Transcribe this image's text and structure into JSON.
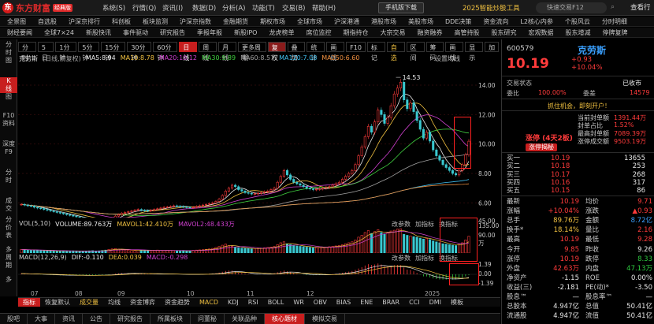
{
  "app": {
    "logo_mark": "东",
    "logo_text": "东方财富",
    "logo_badge": "经典版",
    "menu": [
      "系统(S)",
      "行情(Q)",
      "资讯(I)",
      "数据(D)",
      "分析(A)",
      "功能(T)",
      "交易(B)",
      "帮助(H)"
    ],
    "mobile_btn": "手机版下载",
    "promo": "2025智能炒股工具",
    "shortcut": "快速交易F12",
    "quote_tab": "查看行"
  },
  "nav1": [
    "全景图",
    "自选股",
    "沪深京排行",
    "科创板",
    "板块监测",
    "沪深京指数",
    "金融期货",
    "期权市场",
    "全球市场",
    "沪深港通",
    "港股市场",
    "美股市场",
    "DDE决策",
    "资金流向",
    "L2核心内参",
    "个股风云",
    "分时明细"
  ],
  "nav2": [
    "财经要闻",
    "全球7×24",
    "新股快讯",
    "事件驱动",
    "研究报告",
    "季报年报",
    "新股IPO",
    "龙虎榜单",
    "席位监控",
    "期指持仓",
    "大宗交易",
    "融资融券",
    "高管持股",
    "股东研究",
    "宏观数据",
    "股东增减",
    "停牌复牌"
  ],
  "rail": [
    "分",
    "时",
    "图",
    "K",
    "线",
    "图",
    "F10",
    "资料",
    "深度",
    "F9",
    "分",
    "时",
    "成",
    "交",
    "分",
    "价",
    "表",
    "多",
    "周",
    "期",
    "多"
  ],
  "periods": [
    "分时",
    "5日",
    "1分钟",
    "5分钟",
    "15分钟",
    "30分钟",
    "60分钟",
    "日线",
    "周线",
    "月线",
    "更多周期"
  ],
  "head_buttons": [
    "复权",
    "叠加",
    "统计",
    "画线",
    "F10",
    "标记",
    "自选",
    "区间",
    "筹码",
    "画线",
    "显示",
    "加"
  ],
  "chart_head": {
    "stock_name": "克劳斯",
    "mode": "(日线,前复权)",
    "setting": "设置均线"
  },
  "ma": [
    {
      "label": "MA5:8.94",
      "color": "#e8e8e8"
    },
    {
      "label": "MA10:8.78",
      "color": "#f0c040"
    },
    {
      "label": "MA20:10.12",
      "color": "#d040d0"
    },
    {
      "label": "MA30:9.89",
      "color": "#40d040"
    },
    {
      "label": "MA60:8.57",
      "color": "#a0a0a0"
    },
    {
      "label": "MA120:7.08",
      "color": "#40c0f0"
    },
    {
      "label": "MA250:6.60",
      "color": "#f09040"
    }
  ],
  "vol_head": [
    {
      "label": "VOL(5,10)",
      "color": "#ccc"
    },
    {
      "label": "VOLUME:89.763万",
      "color": "#e8e8e8"
    },
    {
      "label": "MAVOL1:42.410万",
      "color": "#f0c040"
    },
    {
      "label": "MAVOL2:48.433万",
      "color": "#d040d0"
    }
  ],
  "macd_head": [
    {
      "label": "MACD(12,26,9)",
      "color": "#ccc"
    },
    {
      "label": "DIF:-0.110",
      "color": "#e8e8e8"
    },
    {
      "label": "DEA:0.039",
      "color": "#f0c040"
    },
    {
      "label": "MACD:-0.298",
      "color": "#d040d0"
    }
  ],
  "pane_tools": [
    "改参数",
    "加指标",
    "换指标"
  ],
  "indicator_tabs": [
    "指标",
    "恢复默认",
    "成交量",
    "均线",
    "资金博弈",
    "资金趋势",
    "MACD",
    "KDJ",
    "RSI",
    "BOLL",
    "WR",
    "OBV",
    "BIAS",
    "ENE",
    "BRAR",
    "CCI",
    "DMI",
    "模板"
  ],
  "bottom_tabs": [
    "股吧",
    "大事",
    "资讯",
    "公告",
    "研究报告",
    "所属板块",
    "问董秘",
    "关联品种",
    "核心题材",
    "模拟交易"
  ],
  "chart_data": {
    "type": "candlestick",
    "y_ticks": [
      "14.00",
      "12.00",
      "10.00",
      "8.00",
      "6.00"
    ],
    "ylim": [
      5.0,
      15.5
    ],
    "x_ticks": [
      "07",
      "08",
      "09",
      "10",
      "11",
      "12",
      "2025"
    ],
    "annotations": [
      {
        "label": "14.53",
        "x_index": 117,
        "y": 14.53
      },
      {
        "label": "4.69",
        "x_index": 26,
        "y": 4.69
      }
    ],
    "vol_ticks": [
      "135.00",
      "90.00",
      "45.00",
      "万"
    ],
    "macd_ticks": [
      "1.39",
      "0.00",
      "-1.39"
    ],
    "closes": [
      5.9,
      5.85,
      5.8,
      5.78,
      5.7,
      5.65,
      5.62,
      5.55,
      5.5,
      5.45,
      5.4,
      5.35,
      5.3,
      5.25,
      5.2,
      5.15,
      5.1,
      5.05,
      5.0,
      4.95,
      4.9,
      4.85,
      4.8,
      4.78,
      4.75,
      4.72,
      4.7,
      4.8,
      4.95,
      5.1,
      5.2,
      5.3,
      5.35,
      5.4,
      5.45,
      5.5,
      5.55,
      5.5,
      5.48,
      5.45,
      5.5,
      5.55,
      5.6,
      5.65,
      5.7,
      5.72,
      5.75,
      5.8,
      5.78,
      5.75,
      5.72,
      5.7,
      5.68,
      5.7,
      5.75,
      5.8,
      5.85,
      5.9,
      5.95,
      6.0,
      6.1,
      6.25,
      6.5,
      6.8,
      7.0,
      7.2,
      7.1,
      6.9,
      6.8,
      6.7,
      6.65,
      6.6,
      6.62,
      6.65,
      6.7,
      6.75,
      6.8,
      6.9,
      7.0,
      7.4,
      7.8,
      8.2,
      7.9,
      7.6,
      7.4,
      7.3,
      7.2,
      7.1,
      7.0,
      6.95,
      6.9,
      6.92,
      6.95,
      7.0,
      7.05,
      7.1,
      7.2,
      7.3,
      7.4,
      7.6,
      7.8,
      8.0,
      8.2,
      8.6,
      9.2,
      9.8,
      10.5,
      11.2,
      10.8,
      11.5,
      12.3,
      12.0,
      11.4,
      11.8,
      12.6,
      13.4,
      13.8,
      14.2,
      13.0,
      12.4,
      12.8,
      12.2,
      11.6,
      11.0,
      10.4,
      10.8,
      10.2,
      9.6,
      9.2,
      8.9,
      8.6,
      8.4,
      8.2,
      8.0,
      7.9,
      8.2,
      8.6,
      9.27,
      10.19
    ],
    "volumes": [
      20,
      18,
      17,
      15,
      14,
      16,
      15,
      13,
      12,
      14,
      12,
      11,
      13,
      12,
      10,
      11,
      12,
      10,
      9,
      11,
      10,
      12,
      13,
      11,
      12,
      14,
      16,
      20,
      22,
      24,
      21,
      18,
      17,
      16,
      15,
      14,
      16,
      15,
      14,
      13,
      14,
      15,
      16,
      14,
      13,
      15,
      14,
      13,
      12,
      13,
      14,
      12,
      13,
      15,
      16,
      17,
      18,
      20,
      22,
      25,
      30,
      35,
      42,
      48,
      40,
      36,
      30,
      28,
      26,
      25,
      24,
      23,
      24,
      25,
      26,
      28,
      30,
      32,
      35,
      45,
      55,
      60,
      50,
      45,
      40,
      38,
      36,
      34,
      32,
      30,
      28,
      29,
      30,
      31,
      32,
      34,
      36,
      38,
      40,
      44,
      50,
      55,
      60,
      70,
      85,
      95,
      110,
      120,
      105,
      115,
      125,
      110,
      100,
      108,
      118,
      122,
      128,
      130,
      100,
      95,
      92,
      88,
      85,
      80,
      75,
      78,
      72,
      65,
      60,
      55,
      50,
      48,
      45,
      42,
      40,
      46,
      55,
      70,
      90
    ],
    "macd": [
      0.05,
      0.04,
      0.03,
      0.02,
      0.01,
      0.0,
      -0.01,
      -0.02,
      -0.03,
      -0.04,
      -0.05,
      -0.05,
      -0.06,
      -0.06,
      -0.06,
      -0.07,
      -0.07,
      -0.07,
      -0.07,
      -0.07,
      -0.07,
      -0.07,
      -0.06,
      -0.06,
      -0.05,
      -0.05,
      -0.04,
      -0.02,
      0.01,
      0.04,
      0.06,
      0.07,
      0.07,
      0.07,
      0.06,
      0.06,
      0.05,
      0.04,
      0.03,
      0.02,
      0.02,
      0.02,
      0.02,
      0.02,
      0.02,
      0.02,
      0.01,
      0.01,
      0.0,
      0.0,
      -0.01,
      -0.01,
      -0.01,
      0.0,
      0.0,
      0.01,
      0.02,
      0.03,
      0.04,
      0.05,
      0.07,
      0.1,
      0.15,
      0.2,
      0.22,
      0.22,
      0.18,
      0.12,
      0.08,
      0.05,
      0.03,
      0.01,
      0.0,
      0.0,
      0.01,
      0.02,
      0.03,
      0.05,
      0.07,
      0.12,
      0.18,
      0.22,
      0.18,
      0.12,
      0.06,
      0.03,
      0.0,
      -0.02,
      -0.04,
      -0.05,
      -0.05,
      -0.04,
      -0.03,
      -0.02,
      -0.01,
      0.0,
      0.02,
      0.04,
      0.06,
      0.09,
      0.12,
      0.16,
      0.2,
      0.26,
      0.34,
      0.42,
      0.52,
      0.6,
      0.55,
      0.58,
      0.64,
      0.58,
      0.48,
      0.46,
      0.5,
      0.54,
      0.55,
      0.54,
      0.4,
      0.28,
      0.26,
      0.18,
      0.08,
      -0.02,
      -0.12,
      -0.12,
      -0.18,
      -0.24,
      -0.28,
      -0.3,
      -0.31,
      -0.31,
      -0.31,
      -0.31,
      -0.3,
      -0.26,
      -0.2,
      -0.12,
      -0.05
    ]
  },
  "rpanel": {
    "code": "600579",
    "name": "克劳斯",
    "price": "10.19",
    "chg": "+0.93",
    "chg_pct": "+10.04%",
    "status_label": "交易状态",
    "status_value": "已收市",
    "weibi_label": "委比",
    "weibi_value": "100.00%",
    "weicha_label": "委差",
    "weicha_value": "14579",
    "promo": "抓住机会，即刻开户！",
    "limit_title": "涨停 (4天2板)",
    "limit_badge": "涨停揭秘",
    "limit_stats": [
      {
        "label": "当前封单额",
        "value": "1391.44万"
      },
      {
        "label": "封单占比",
        "value": "1.52%"
      },
      {
        "label": "最高封单额",
        "value": "7089.39万"
      },
      {
        "label": "涨停成交额",
        "value": "9503.19万"
      }
    ],
    "book": [
      {
        "label": "买一",
        "price": "10.19",
        "vol": "13655"
      },
      {
        "label": "买二",
        "price": "10.18",
        "vol": "253"
      },
      {
        "label": "买三",
        "price": "10.17",
        "vol": "268"
      },
      {
        "label": "买四",
        "price": "10.16",
        "vol": "317"
      },
      {
        "label": "买五",
        "price": "10.15",
        "vol": "86"
      }
    ],
    "stats": [
      {
        "a": "最新",
        "av": "10.19",
        "ac": "red",
        "b": "均价",
        "bv": "9.71",
        "bc": "red"
      },
      {
        "a": "涨幅",
        "av": "+10.04%",
        "ac": "red",
        "b": "涨跌",
        "bv": "▲0.93",
        "bc": "red"
      },
      {
        "a": "总手",
        "av": "89.76万",
        "ac": "yellowc",
        "b": "金额",
        "bv": "8.72亿",
        "bc": "blue"
      },
      {
        "a": "换手*",
        "av": "18.14%",
        "ac": "yellowc",
        "b": "量比",
        "bv": "2.16",
        "bc": "red"
      },
      {
        "a": "最高",
        "av": "10.19",
        "ac": "red",
        "b": "最低",
        "bv": "9.28",
        "bc": "red"
      },
      {
        "a": "今开",
        "av": "9.85",
        "ac": "red",
        "b": "昨收",
        "bv": "9.26",
        "bc": "white"
      },
      {
        "a": "涨停",
        "av": "10.19",
        "ac": "red",
        "b": "跌停",
        "bv": "8.33",
        "bc": "green"
      },
      {
        "a": "外盘",
        "av": "42.63万",
        "ac": "red",
        "b": "内盘",
        "bv": "47.13万",
        "bc": "green"
      },
      {
        "a": "净资产",
        "av": "-1.15",
        "ac": "white",
        "b": "ROE",
        "bv": "0.00%",
        "bc": "white"
      },
      {
        "a": "收益(三)",
        "av": "-2.181",
        "ac": "white",
        "b": "PE(动)*",
        "bv": "-3.50",
        "bc": "white"
      },
      {
        "a": "股息™",
        "av": "—",
        "ac": "white",
        "b": "股息率™",
        "bv": "—",
        "bc": "white"
      },
      {
        "a": "总股本",
        "av": "4.947亿",
        "ac": "white",
        "b": "总值",
        "bv": "50.41亿",
        "bc": "white"
      },
      {
        "a": "流通股",
        "av": "4.947亿",
        "ac": "white",
        "b": "流值",
        "bv": "50.41亿",
        "bc": "white"
      }
    ]
  }
}
